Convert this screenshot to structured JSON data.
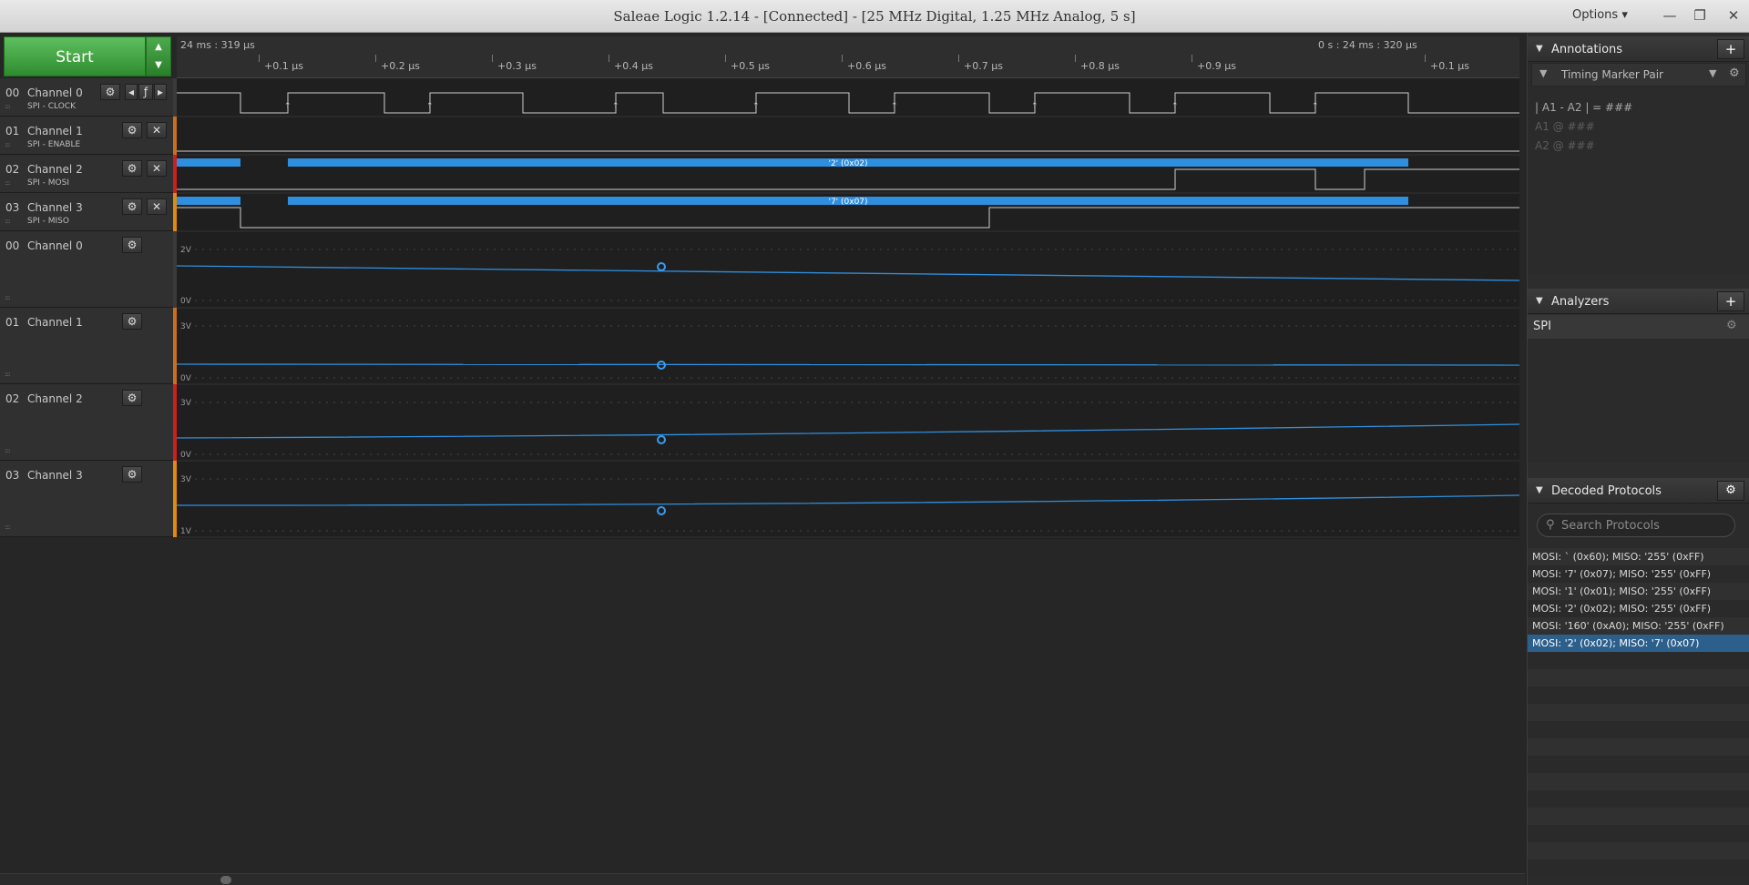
{
  "window": {
    "title": "Saleae Logic 1.2.14 - [Connected] - [25 MHz Digital, 1.25 MHz Analog, 5 s]",
    "options_label": "Options",
    "options_caret": "▾",
    "minimize": "—",
    "restore": "❐",
    "close": "✕"
  },
  "toolbar": {
    "start_label": "Start",
    "arrow_up": "▲",
    "arrow_down": "▼"
  },
  "ruler": {
    "left_time": "24 ms : 319 µs",
    "right_time": "0 s : 24 ms : 320 µs",
    "ticks": [
      "+0.1 µs",
      "+0.2 µs",
      "+0.3 µs",
      "+0.4 µs",
      "+0.5 µs",
      "+0.6 µs",
      "+0.7 µs",
      "+0.8 µs",
      "+0.9 µs",
      "+0.1 µs"
    ]
  },
  "digital_channels": [
    {
      "num": "00",
      "name": "Channel 0",
      "sub": "SPI - CLOCK",
      "color": "#3a3a3a"
    },
    {
      "num": "01",
      "name": "Channel 1",
      "sub": "SPI - ENABLE",
      "color": "#c8701c"
    },
    {
      "num": "02",
      "name": "Channel 2",
      "sub": "SPI - MOSI",
      "color": "#cc2020"
    },
    {
      "num": "03",
      "name": "Channel 3",
      "sub": "SPI - MISO",
      "color": "#e08a10"
    }
  ],
  "analog_channels": [
    {
      "num": "00",
      "name": "Channel 0",
      "hi": "2V",
      "lo": "0V",
      "color": "#3a3a3a"
    },
    {
      "num": "01",
      "name": "Channel 1",
      "hi": "3V",
      "lo": "0V",
      "color": "#c8701c"
    },
    {
      "num": "02",
      "name": "Channel 2",
      "hi": "3V",
      "lo": "0V",
      "color": "#cc2020"
    },
    {
      "num": "03",
      "name": "Channel 3",
      "hi": "3V",
      "lo": "1V",
      "color": "#e08a10"
    }
  ],
  "decode": {
    "mosi_label": "'2' (0x02)",
    "miso_label": "'7' (0x07)"
  },
  "annotations": {
    "title": "Annotations",
    "add": "+",
    "marker_pair": "Timing Marker Pair",
    "line1": "| A1 - A2 | = ###",
    "line2": "A1  @  ###",
    "line3": "A2  @  ###"
  },
  "analyzers": {
    "title": "Analyzers",
    "add": "+",
    "items": [
      "SPI"
    ]
  },
  "decoded": {
    "title": "Decoded Protocols",
    "search_placeholder": "Search Protocols",
    "rows": [
      "MOSI: ` (0x60);  MISO: '255' (0xFF)",
      "MOSI: '7' (0x07);  MISO: '255' (0xFF)",
      "MOSI: '1' (0x01);  MISO: '255' (0xFF)",
      "MOSI: '2' (0x02);  MISO: '255' (0xFF)",
      "MOSI: '160' (0xA0);  MISO: '255' (0xFF)",
      "MOSI: '2' (0x02);  MISO: '7' (0x07)"
    ],
    "selected_index": 5
  },
  "colors": {
    "accent_blue": "#2e8fe0",
    "start_green": "#3da33d",
    "selected_row": "#2d5f8c"
  }
}
